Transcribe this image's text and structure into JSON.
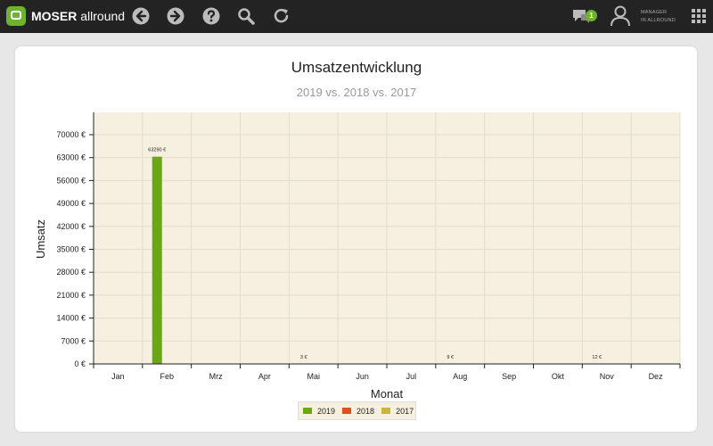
{
  "app": {
    "brand_bold": "MOSER",
    "brand_rest": "allround",
    "notification_count": "1",
    "user_role_line1": "MANAGER",
    "user_role_line2": "IN ALLROUND"
  },
  "toolbar": {
    "icons": [
      "back-icon",
      "forward-icon",
      "help-icon",
      "search-icon",
      "refresh-icon"
    ]
  },
  "chart_data": {
    "type": "bar",
    "title": "Umsatzentwicklung",
    "subtitle": "2019 vs. 2018 vs. 2017",
    "xlabel": "Monat",
    "ylabel": "Umsatz",
    "categories": [
      "Jan",
      "Feb",
      "Mrz",
      "Apr",
      "Mai",
      "Jun",
      "Jul",
      "Aug",
      "Sep",
      "Okt",
      "Nov",
      "Dez"
    ],
    "yticks": [
      "0 €",
      "7000 €",
      "14000 €",
      "21000 €",
      "28000 €",
      "35000 €",
      "42000 €",
      "49000 €",
      "56000 €",
      "63000 €",
      "70000 €"
    ],
    "ylim": [
      0,
      70000
    ],
    "series": [
      {
        "name": "2019",
        "color": "#6aa715",
        "values": [
          0,
          63290,
          0,
          0,
          3,
          0,
          0,
          9,
          0,
          0,
          12,
          0
        ]
      },
      {
        "name": "2018",
        "color": "#d9531e",
        "values": [
          0,
          0,
          0,
          0,
          0,
          0,
          0,
          0,
          0,
          0,
          0,
          0
        ]
      },
      {
        "name": "2017",
        "color": "#c9b53a",
        "values": [
          0,
          0,
          0,
          0,
          0,
          0,
          0,
          0,
          0,
          0,
          0,
          0
        ]
      }
    ],
    "data_labels": [
      {
        "category": "Feb",
        "series": "2019",
        "text": "63290 €"
      },
      {
        "category": "Mai",
        "series": "2019",
        "text": "3 €"
      },
      {
        "category": "Aug",
        "series": "2019",
        "text": "9 €"
      },
      {
        "category": "Nov",
        "series": "2019",
        "text": "12 €"
      }
    ],
    "grid": true,
    "plot_background": "#f7f0e1",
    "legend": "bottom-center"
  }
}
